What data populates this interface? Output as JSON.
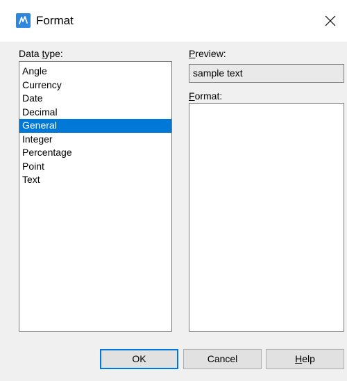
{
  "window": {
    "title": "Format",
    "app_icon": "format-app-icon",
    "close_icon": "close-icon"
  },
  "data_type": {
    "label_prefix": "Data ",
    "label_mnemonic": "t",
    "label_suffix": "ype:",
    "items": [
      "Angle",
      "Currency",
      "Date",
      "Decimal",
      "General",
      "Integer",
      "Percentage",
      "Point",
      "Text"
    ],
    "selected": "General"
  },
  "preview": {
    "label_mnemonic": "P",
    "label_suffix": "review:",
    "value": "sample text"
  },
  "format": {
    "label_mnemonic": "F",
    "label_suffix": "ormat:"
  },
  "buttons": {
    "ok": "OK",
    "cancel": "Cancel",
    "help_mnemonic": "H",
    "help_suffix": "elp"
  },
  "colors": {
    "selection": "#0078d7",
    "app_icon": "#2e86de"
  }
}
